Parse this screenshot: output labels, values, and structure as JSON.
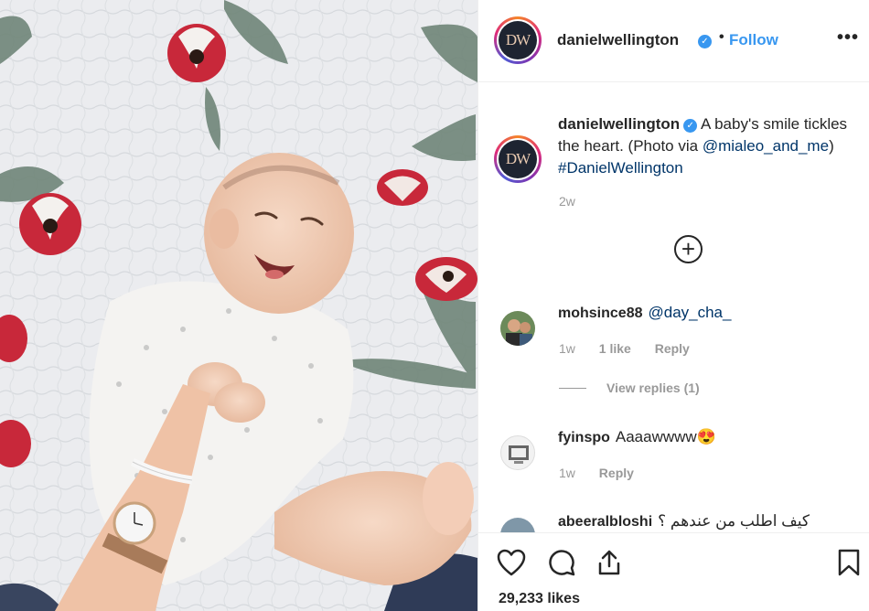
{
  "post": {
    "avatar_text": "DW",
    "username": "danielwellington",
    "verified_mark": "✓",
    "separator": "•",
    "follow_label": "Follow",
    "more_label": "•••",
    "caption": {
      "text": "A baby's smile tickles the heart. (Photo via ",
      "mention": "@mialeo_and_me",
      "hashtag": "#DanielWellington",
      "close": ")",
      "time": "2w"
    },
    "load_more_label": "+"
  },
  "comments": [
    {
      "username": "mohsince88",
      "mention": "@day_cha_",
      "text": "",
      "time": "1w",
      "likes": "1 like",
      "reply": "Reply",
      "view_replies": "View replies (1)"
    },
    {
      "username": "fyinspo",
      "mention": "",
      "text": "Aaaawwww😍",
      "time": "1w",
      "reply": "Reply"
    },
    {
      "username": "abeeralbloshi",
      "text": "كيف اطلب من عندهم ؟"
    }
  ],
  "likes_count": "29,233 likes",
  "icons": {
    "like": "heart-icon",
    "comment": "comment-icon",
    "share": "share-icon",
    "save": "bookmark-icon"
  },
  "colors": {
    "link": "#003569",
    "follow": "#3897f0",
    "muted": "#999999",
    "brand_avatar_bg": "#1e2431"
  }
}
